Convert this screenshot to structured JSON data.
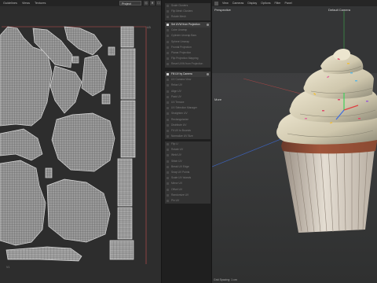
{
  "uv_editor": {
    "menu": [
      "Guidelines",
      "Views",
      "Textures"
    ],
    "project_select": "Project",
    "tools": [
      "◇",
      "✕",
      "□"
    ],
    "axis_u_label": "U1",
    "axis_v_label": "V1"
  },
  "attributes": {
    "groups": [
      {
        "rows": [
          {
            "label": "Scale Clusters",
            "active": false
          },
          {
            "label": "Flip Mesh Clusters",
            "active": false
          },
          {
            "label": "Rotate Mesh",
            "active": false
          }
        ]
      },
      {
        "rows": [
          {
            "label": "Set UVW from Projection",
            "active": true
          },
          {
            "label": "Cube Unwrap",
            "active": false
          },
          {
            "label": "Cylinder Unwrap Bars",
            "active": false
          },
          {
            "label": "Sphere Unwrap",
            "active": false
          },
          {
            "label": "Frontal Projection",
            "active": false
          },
          {
            "label": "Planar Projection",
            "active": false
          },
          {
            "label": "Flip Projection Mapping",
            "active": false
          },
          {
            "label": "Reset UVW from Projection",
            "active": false
          }
        ]
      },
      {
        "rows": [
          {
            "label": "Fill UV by Camera",
            "active": true
          },
          {
            "label": "UV Camera View",
            "active": false
          },
          {
            "label": "Relax UV",
            "active": false
          },
          {
            "label": "Align UV",
            "active": false
          },
          {
            "label": "Pack UV",
            "active": false
          },
          {
            "label": "UV Terrace",
            "active": false
          },
          {
            "label": "UV Selection Manager",
            "active": false
          },
          {
            "label": "Straighten UV",
            "active": false
          },
          {
            "label": "Rectangularize",
            "active": false
          },
          {
            "label": "Distribute UV",
            "active": false
          },
          {
            "label": "Fit UV to Bounds",
            "active": false
          },
          {
            "label": "Normalize UV Size",
            "active": false
          }
        ]
      },
      {
        "rows": [
          {
            "label": "Flip U",
            "active": false
          },
          {
            "label": "Rotate UV",
            "active": false
          },
          {
            "label": "Weld UV",
            "active": false
          },
          {
            "label": "Stitch UV",
            "active": false
          },
          {
            "label": "Break UV Edge",
            "active": false
          },
          {
            "label": "Snap UV Points",
            "active": false
          },
          {
            "label": "Scale UV Islands",
            "active": false
          },
          {
            "label": "Mirror UV",
            "active": false
          },
          {
            "label": "Offset UV",
            "active": false
          },
          {
            "label": "Randomize UV",
            "active": false
          },
          {
            "label": "Pin UV",
            "active": false
          }
        ]
      }
    ]
  },
  "viewport": {
    "menu": [
      "View",
      "Cameras",
      "Display",
      "Options",
      "Filter",
      "Panel"
    ],
    "label": "Perspective",
    "camera": "Default Camera",
    "more_label": "More",
    "bottom_label": "Grid Spacing: 1 cm"
  }
}
